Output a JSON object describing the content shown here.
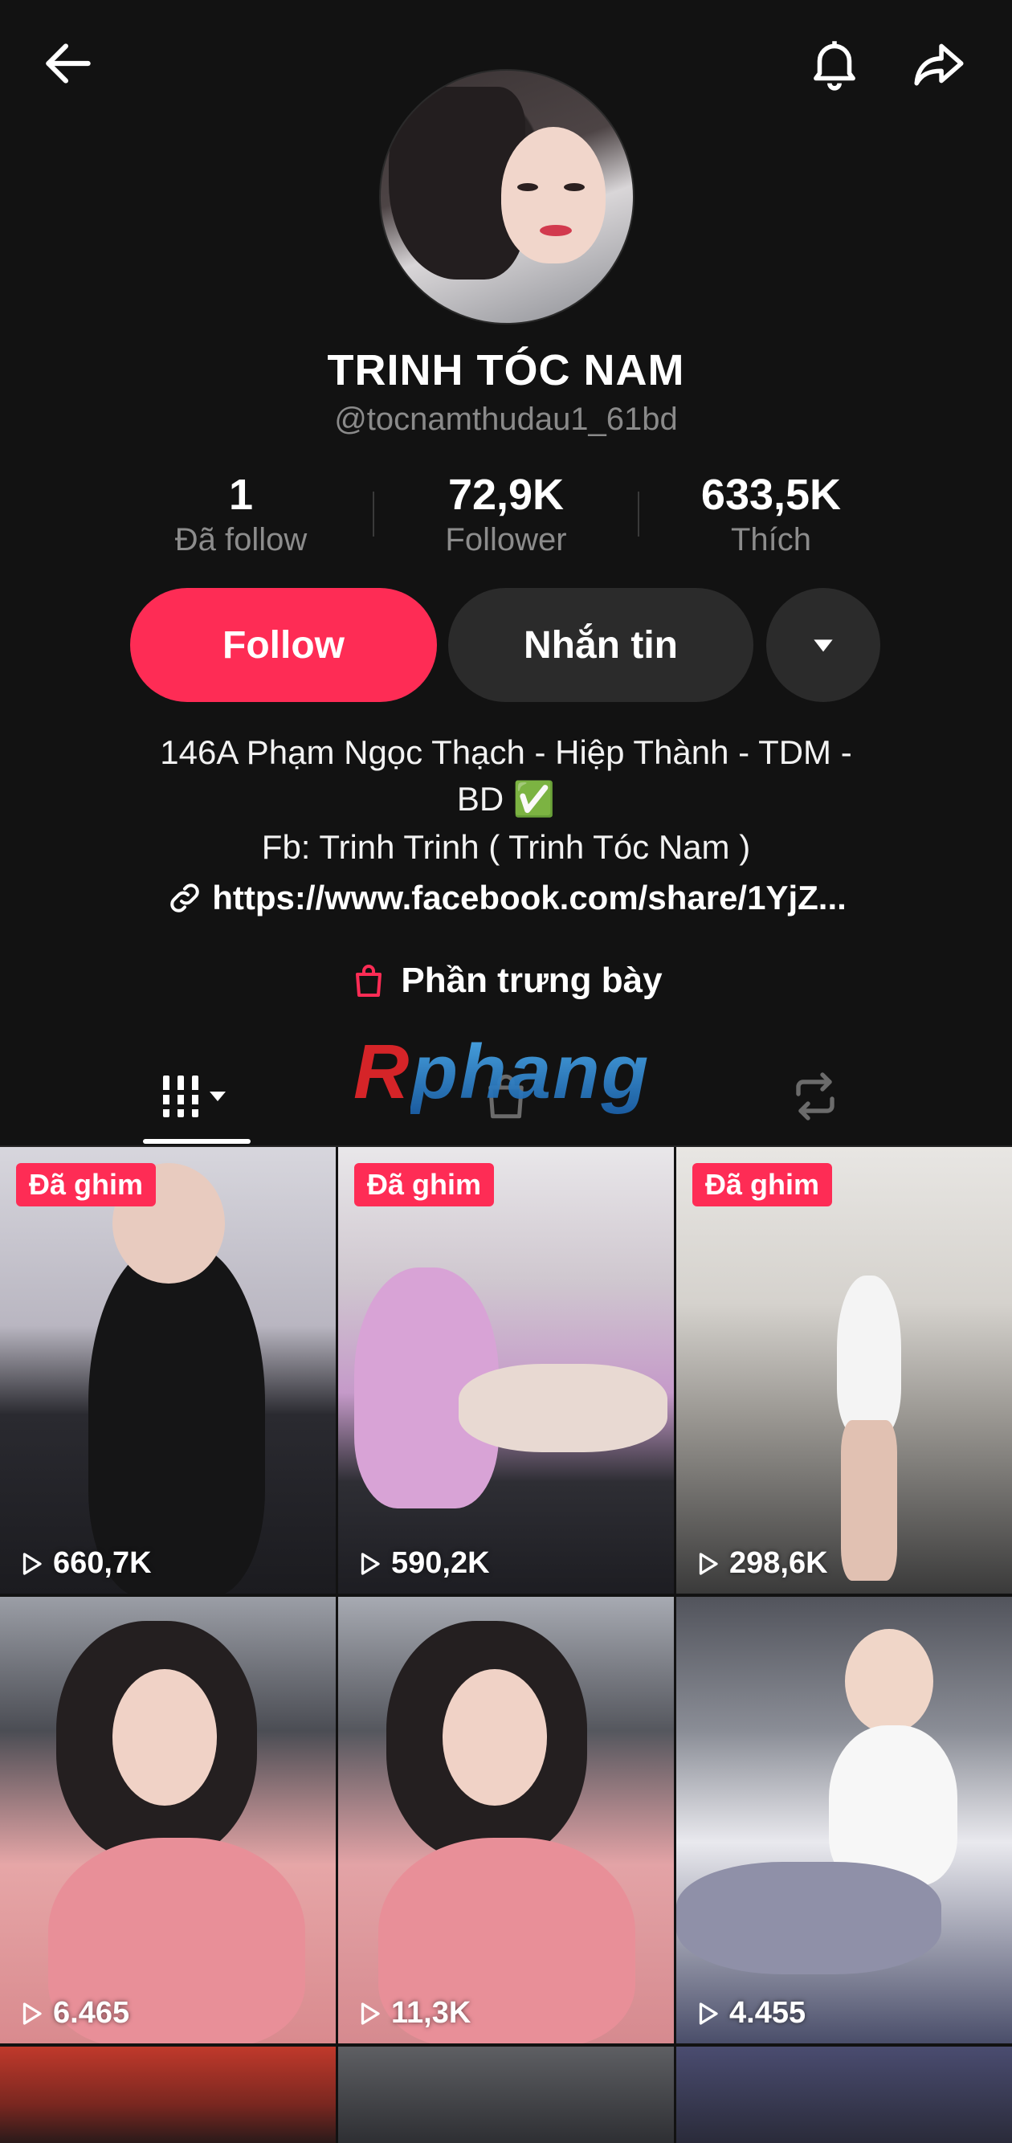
{
  "profile": {
    "display_name": "TRINH TÓC NAM",
    "username": "@tocnamthudau1_61bd"
  },
  "stats": [
    {
      "value": "1",
      "label": "Đã follow"
    },
    {
      "value": "72,9K",
      "label": "Follower"
    },
    {
      "value": "633,5K",
      "label": "Thích"
    }
  ],
  "actions": {
    "follow_label": "Follow",
    "message_label": "Nhắn tin"
  },
  "bio": {
    "line1": "146A Phạm Ngọc Thạch - Hiệp Thành - TDM -",
    "line2": "BD ✅",
    "line3": "Fb: Trinh Trinh ( Trinh Tóc Nam )",
    "link": "https://www.facebook.com/share/1YjZ..."
  },
  "showcase_label": "Phần trưng bày",
  "watermark": {
    "first": "R",
    "rest": "phang"
  },
  "colors": {
    "accent": "#fe2c55",
    "background": "#121212",
    "secondary_button": "#2b2b2b"
  },
  "videos": [
    {
      "pinned": "Đã ghim",
      "views": "660,7K"
    },
    {
      "pinned": "Đã ghim",
      "views": "590,2K"
    },
    {
      "pinned": "Đã ghim",
      "views": "298,6K"
    },
    {
      "pinned": "",
      "views": "6.465"
    },
    {
      "pinned": "",
      "views": "11,3K"
    },
    {
      "pinned": "",
      "views": "4.455"
    }
  ]
}
